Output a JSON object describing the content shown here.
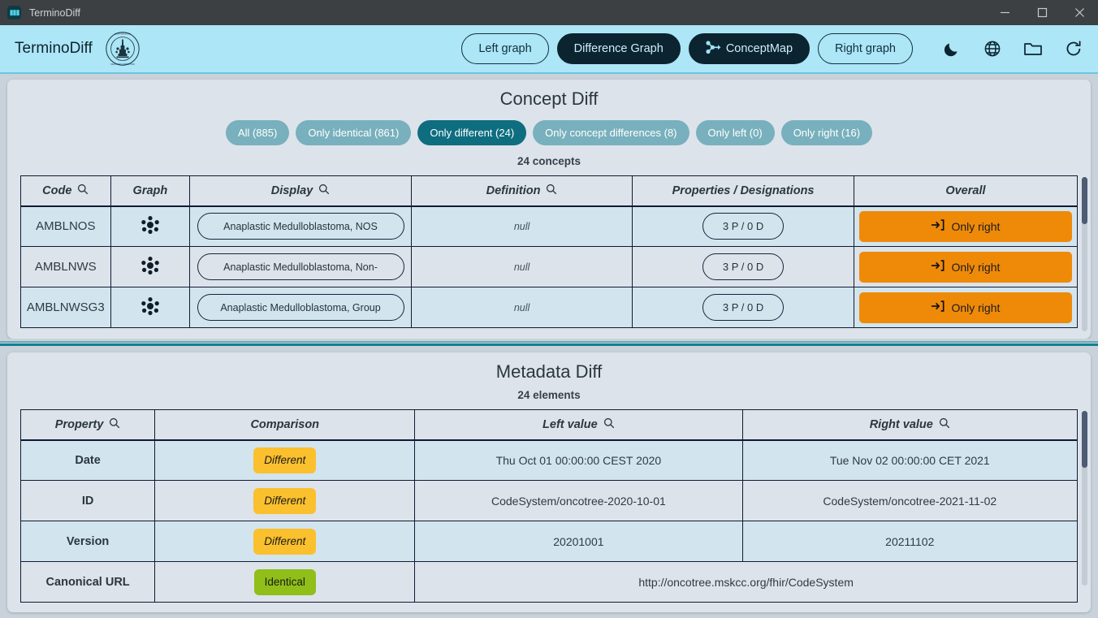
{
  "window": {
    "title": "TerminoDiff",
    "app_icon": "app-logo-icon",
    "minimize": "minimize-icon",
    "maximize": "maximize-icon",
    "close": "close-icon"
  },
  "header": {
    "brand": "TerminoDiff",
    "seal": "university-seal-logo",
    "nav": [
      {
        "label": "Left graph",
        "style": "outline",
        "icon": null
      },
      {
        "label": "Difference Graph",
        "style": "filled",
        "icon": null
      },
      {
        "label": "ConceptMap",
        "style": "filled",
        "icon": "concept-map-icon"
      },
      {
        "label": "Right graph",
        "style": "outline",
        "icon": null
      }
    ],
    "icons": [
      {
        "name": "dark-mode-icon",
        "glyph": "moon"
      },
      {
        "name": "language-icon",
        "glyph": "globe"
      },
      {
        "name": "open-folder-icon",
        "glyph": "folder"
      },
      {
        "name": "reload-icon",
        "glyph": "refresh"
      }
    ]
  },
  "concept_diff": {
    "title": "Concept Diff",
    "filters": [
      {
        "label": "All (885)",
        "active": false
      },
      {
        "label": "Only identical (861)",
        "active": false
      },
      {
        "label": "Only different (24)",
        "active": true
      },
      {
        "label": "Only concept differences (8)",
        "active": false
      },
      {
        "label": "Only left (0)",
        "active": false
      },
      {
        "label": "Only right (16)",
        "active": false
      }
    ],
    "count_label": "24 concepts",
    "columns": [
      {
        "label": "Code",
        "searchable": true
      },
      {
        "label": "Graph",
        "searchable": false
      },
      {
        "label": "Display",
        "searchable": true
      },
      {
        "label": "Definition",
        "searchable": true
      },
      {
        "label": "Properties / Designations",
        "searchable": false
      },
      {
        "label": "Overall",
        "searchable": false
      }
    ],
    "rows": [
      {
        "code": "AMBLNOS",
        "graph_icon": "graph-node-icon",
        "display": "Anaplastic Medulloblastoma, NOS",
        "definition": "null",
        "properties": "3 P / 0 D",
        "overall": "Only right",
        "overall_icon": "arrow-into-bracket-icon"
      },
      {
        "code": "AMBLNWS",
        "graph_icon": "graph-node-icon",
        "display": "Anaplastic Medulloblastoma, Non-",
        "definition": "null",
        "properties": "3 P / 0 D",
        "overall": "Only right",
        "overall_icon": "arrow-into-bracket-icon"
      },
      {
        "code": "AMBLNWSG3",
        "graph_icon": "graph-node-icon",
        "display": "Anaplastic Medulloblastoma, Group",
        "definition": "null",
        "properties": "3 P / 0 D",
        "overall": "Only right",
        "overall_icon": "arrow-into-bracket-icon"
      }
    ]
  },
  "metadata_diff": {
    "title": "Metadata Diff",
    "count_label": "24 elements",
    "columns": [
      {
        "label": "Property",
        "searchable": true
      },
      {
        "label": "Comparison",
        "searchable": false
      },
      {
        "label": "Left value",
        "searchable": true
      },
      {
        "label": "Right value",
        "searchable": true
      }
    ],
    "rows": [
      {
        "property": "Date",
        "comparison": "Different",
        "comparison_kind": "different",
        "merged": false,
        "left": "Thu Oct 01 00:00:00 CEST 2020",
        "right": "Tue Nov 02 00:00:00 CET 2021"
      },
      {
        "property": "ID",
        "comparison": "Different",
        "comparison_kind": "different",
        "merged": false,
        "left": "CodeSystem/oncotree-2020-10-01",
        "right": "CodeSystem/oncotree-2021-11-02"
      },
      {
        "property": "Version",
        "comparison": "Different",
        "comparison_kind": "different",
        "merged": false,
        "left": "20201001",
        "right": "20211102"
      },
      {
        "property": "Canonical URL",
        "comparison": "Identical",
        "comparison_kind": "identical",
        "merged": true,
        "left": "http://oncotree.mskcc.org/fhir/CodeSystem",
        "right": ""
      }
    ]
  },
  "colors": {
    "header_bg": "#ace6f7",
    "panel_bg": "#dde3ea",
    "row_bg": "#d2e5ee",
    "accent_active_chip": "#0e6e80",
    "chip": "#78b0bd",
    "orange_badge": "#ef8a09",
    "amber_badge": "#fbc02d",
    "green_badge": "#8fbf18",
    "border": "#101b33"
  }
}
